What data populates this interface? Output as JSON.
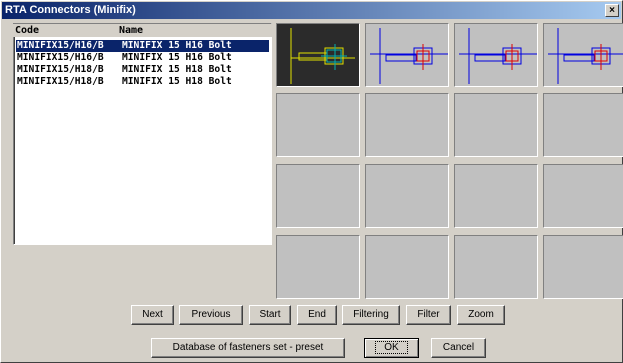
{
  "window": {
    "title": "RTA Connectors (Minifix)",
    "close": "×"
  },
  "list": {
    "columns": [
      "Code",
      "Name"
    ],
    "rows": [
      {
        "code": "MINIFIX15/H16/B",
        "name": "MINIFIX 15 H16 Bolt",
        "selected": true
      },
      {
        "code": "MINIFIX15/H16/B",
        "name": "MINIFIX 15 H16 Bolt",
        "selected": false
      },
      {
        "code": "MINIFIX15/H18/B",
        "name": "MINIFIX 15 H18 Bolt",
        "selected": false
      },
      {
        "code": "MINIFIX15/H18/B",
        "name": "MINIFIX 15 H18 Bolt",
        "selected": false
      }
    ]
  },
  "nav_buttons": {
    "next": "Next",
    "previous": "Previous",
    "start": "Start",
    "end": "End",
    "filtering": "Filtering",
    "filter": "Filter",
    "zoom": "Zoom"
  },
  "bottom_buttons": {
    "database": "Database of fasteners set - preset",
    "ok": "OK",
    "cancel": "Cancel"
  },
  "colors": {
    "titlebar_start": "#0a246a",
    "selection": "#0a246a",
    "tile_bg": "#c0c0c0"
  }
}
